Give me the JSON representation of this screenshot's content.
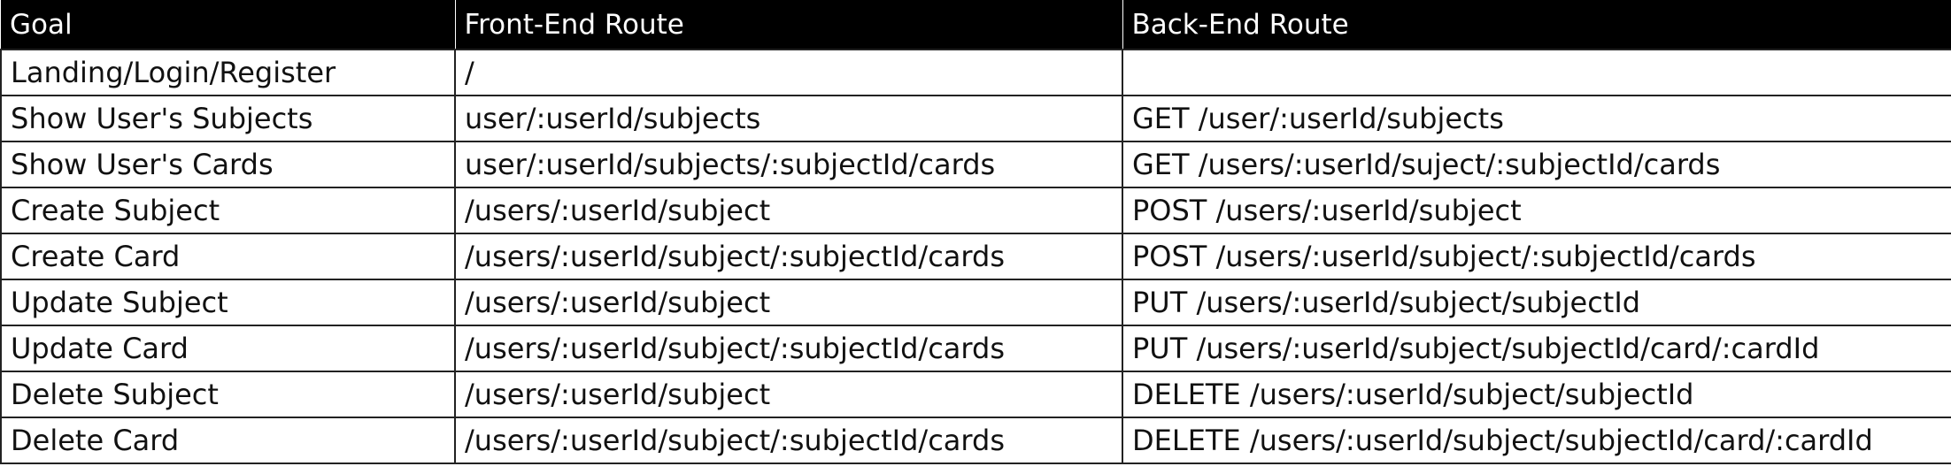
{
  "table": {
    "headers": [
      "Goal",
      "Front-End Route",
      "Back-End Route"
    ],
    "rows": [
      [
        "Landing/Login/Register",
        "/",
        ""
      ],
      [
        "Show User's Subjects",
        "user/:userId/subjects",
        "GET /user/:userId/subjects"
      ],
      [
        "Show User's Cards",
        "user/:userId/subjects/:subjectId/cards",
        "GET /users/:userId/suject/:subjectId/cards"
      ],
      [
        "Create Subject",
        "/users/:userId/subject",
        "POST /users/:userId/subject"
      ],
      [
        "Create Card",
        "/users/:userId/subject/:subjectId/cards",
        "POST /users/:userId/subject/:subjectId/cards"
      ],
      [
        "Update Subject",
        "/users/:userId/subject",
        "PUT /users/:userId/subject/subjectId"
      ],
      [
        "Update Card",
        "/users/:userId/subject/:subjectId/cards",
        "PUT /users/:userId/subject/subjectId/card/:cardId"
      ],
      [
        "Delete Subject",
        "/users/:userId/subject",
        "DELETE /users/:userId/subject/subjectId"
      ],
      [
        "Delete Card",
        "/users/:userId/subject/:subjectId/cards",
        "DELETE /users/:userId/subject/subjectId/card/:cardId"
      ]
    ]
  }
}
